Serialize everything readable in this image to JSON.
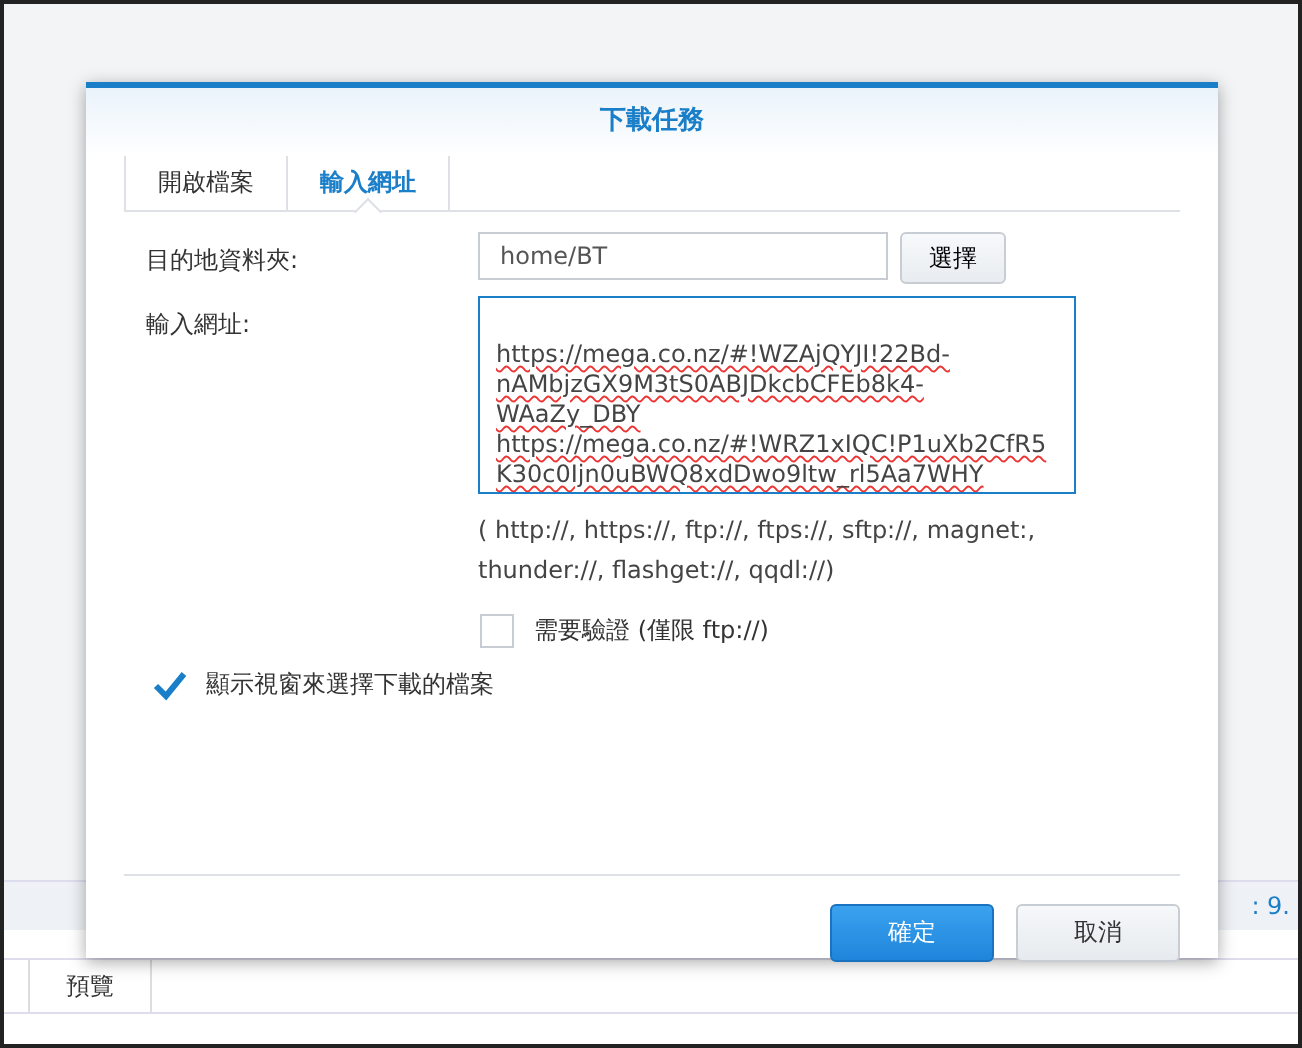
{
  "background": {
    "status_text": ": 9.",
    "tabs": [
      {
        "label": "預覽",
        "selected": false
      }
    ]
  },
  "dialog": {
    "title": "下載任務",
    "tabs": [
      {
        "label": "開啟檔案",
        "selected": false
      },
      {
        "label": "輸入網址",
        "selected": true
      }
    ],
    "destination": {
      "label": "目的地資料夾:",
      "value": "home/BT",
      "button": "選擇"
    },
    "url": {
      "label": "輸入網址:",
      "urls": [
        "https://mega.co.nz/#!WZAjQYJI!22Bd-nAMbjzGX9M3tS0ABJDkcbCFEb8k4-WAaZy_DBY",
        "https://mega.co.nz/#!WRZ1xIQC!P1uXb2CfR5K30c0Ijn0uBWQ8xdDwo9ltw_rl5Aa7WHY"
      ]
    },
    "hint": "( http://, https://, ftp://, ftps://, sftp://, magnet:, thunder://, flashget://, qqdl://)",
    "options": [
      {
        "label": "需要驗證 (僅限 ftp://)",
        "checked": false,
        "kind": "sub"
      },
      {
        "label": "顯示視窗來選擇下載的檔案",
        "checked": true,
        "kind": "main"
      }
    ],
    "buttons": [
      {
        "label": "確定",
        "kind": "primary"
      },
      {
        "label": "取消",
        "kind": "secondary"
      }
    ]
  }
}
